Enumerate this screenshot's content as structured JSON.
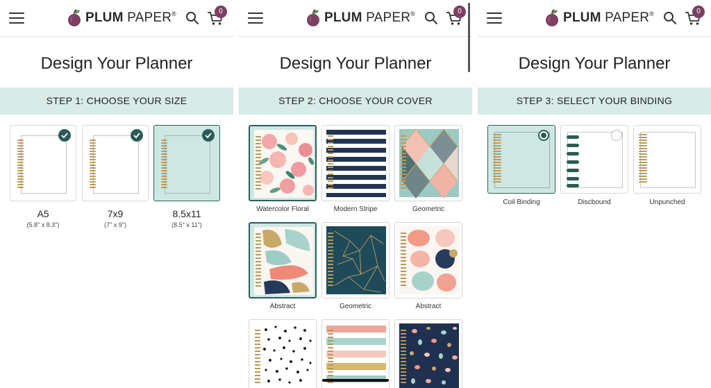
{
  "brand": {
    "name_bold": "PLUM",
    "name_rest": " PAPER",
    "reg": "®",
    "accent": "#7d3f63",
    "teal": "#d8ebe7",
    "dark_teal": "#2b5b57"
  },
  "header": {
    "cart_count": "0",
    "menu_icon": "hamburger-menu-icon",
    "search_icon": "search-icon",
    "cart_icon": "cart-icon"
  },
  "page_title": "Design Your Planner",
  "step1": {
    "label": "STEP 1: CHOOSE YOUR SIZE",
    "options": [
      {
        "label": "A5",
        "sub": "(5.8\" x 8.3\")"
      },
      {
        "label": "7x9",
        "sub": "(7\" x 9\")"
      },
      {
        "label": "8.5x11",
        "sub": "(8.5\" x 11\")"
      }
    ],
    "selected": "8.5x11"
  },
  "step2": {
    "label": "STEP 2: CHOOSE YOUR COVER",
    "covers": [
      {
        "label": "Watercolor Floral",
        "pattern": "floral"
      },
      {
        "label": "Modern Stripe",
        "pattern": "stripe"
      },
      {
        "label": "Geometric",
        "pattern": "diamond"
      },
      {
        "label": "Abstract",
        "pattern": "brush"
      },
      {
        "label": "Geometric",
        "pattern": "navy-geo"
      },
      {
        "label": "Abstract",
        "pattern": "blob"
      },
      {
        "label": "",
        "pattern": "dots"
      },
      {
        "label": "",
        "pattern": "watercolor-stripe"
      },
      {
        "label": "",
        "pattern": "terrazzo"
      }
    ],
    "selected": [
      "Watercolor Floral",
      "Abstract"
    ]
  },
  "step3": {
    "label": "STEP 3: SELECT YOUR BINDING",
    "options": [
      {
        "label": "Coil Binding"
      },
      {
        "label": "Discbound"
      },
      {
        "label": "Unpunched"
      }
    ],
    "selected": "Coil Binding"
  }
}
